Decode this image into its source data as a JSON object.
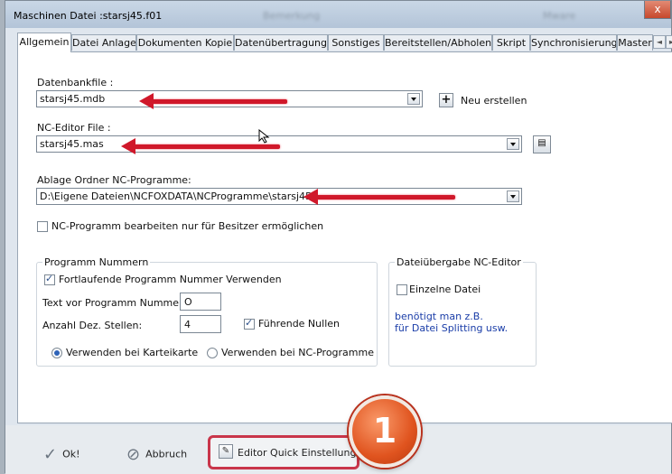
{
  "window": {
    "title": "Maschinen Datei :starsj45.f01",
    "ghost_left": "Bemerkung",
    "ghost_right": "Mware",
    "close_glyph": "x"
  },
  "tabs": [
    {
      "label": "Allgemein",
      "active": true
    },
    {
      "label": "Datei Anlage"
    },
    {
      "label": "Dokumenten Kopie"
    },
    {
      "label": "Datenübertragung"
    },
    {
      "label": "Sonstiges"
    },
    {
      "label": "Bereitstellen/Abholen"
    },
    {
      "label": "Skript"
    },
    {
      "label": "Synchronisierung"
    },
    {
      "label": "Master"
    }
  ],
  "tab_scroll": {
    "left": "◄",
    "right": "►"
  },
  "datenbank": {
    "label": "Datenbankfile :",
    "value": "starsj45.mdb",
    "new_label": "Neu erstellen",
    "new_icon": "plus-icon"
  },
  "nceditor": {
    "label": "NC-Editor File :",
    "value": "starsj45.mas",
    "browse_icon": "folder-browse-icon"
  },
  "ablage": {
    "label": "Ablage Ordner NC-Programme:",
    "value": "D:\\Eigene Dateien\\NCFOXDATA\\NCProgramme\\starsj45"
  },
  "nc_bearbeiten": {
    "label": "NC-Programm bearbeiten nur für Besitzer ermöglichen",
    "checked": false
  },
  "programm_nummern": {
    "title": "Programm Nummern",
    "fortlaufend_label": "Fortlaufende Programm Nummer Verwenden",
    "fortlaufend_checked": true,
    "text_vor_label": "Text vor Programm Nummer:",
    "text_vor_value": "O",
    "anzahl_label": "Anzahl Dez. Stellen:",
    "anzahl_value": "4",
    "fuehrende_label": "Führende Nullen",
    "fuehrende_checked": true,
    "radio_karteikarte": "Verwenden bei Karteikarte",
    "radio_ncprogramme": "Verwenden bei NC-Programme",
    "selected": "karteikarte"
  },
  "dateiuebergabe": {
    "title": "Dateiübergabe NC-Editor",
    "einzelne_label": "Einzelne Datei",
    "einzelne_checked": false,
    "note_line1": "benötigt man z.B.",
    "note_line2": "für Datei Splitting usw."
  },
  "buttons": {
    "ok": "Ok!",
    "ok_icon": "checkmark-icon",
    "abbruch": "Abbruch",
    "abbruch_icon": "cancel-circle-icon",
    "editor_quick": "Editor Quick Einstellungen",
    "editor_quick_icon": "pencil-edit-icon"
  },
  "annotation": {
    "badge_number": "1",
    "arrow_color": "#d0182a",
    "badge_color": "#e0541f"
  }
}
